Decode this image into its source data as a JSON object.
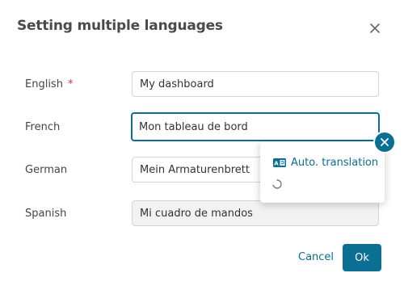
{
  "dialog": {
    "title": "Setting multiple languages",
    "close_icon": "close-icon",
    "required_marker": "*",
    "fields": [
      {
        "label": "English",
        "value": "My dashboard",
        "required": true
      },
      {
        "label": "French",
        "value": "Mon tableau de bord",
        "required": false
      },
      {
        "label": "German",
        "value": "Mein Armaturenbrett",
        "required": false
      },
      {
        "label": "Spanish",
        "value": "Mi cuadro de mandos",
        "required": false
      }
    ],
    "translation_popup": {
      "link_label": "Auto. translation",
      "icon": "translate-icon",
      "loading_icon": "spinner-icon",
      "close_icon": "close-icon"
    },
    "buttons": {
      "cancel": "Cancel",
      "ok": "Ok"
    },
    "colors": {
      "accent": "#0a6f92",
      "required": "#d9304a"
    }
  }
}
